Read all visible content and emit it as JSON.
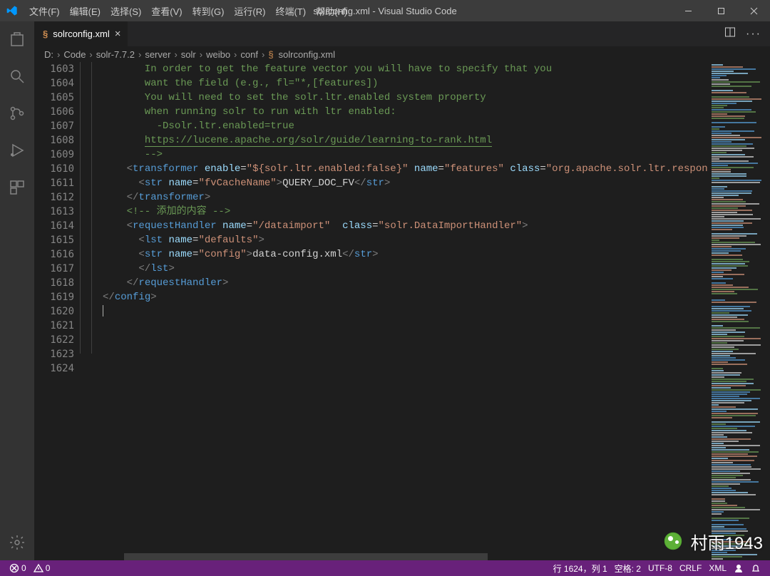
{
  "menu": {
    "file": "文件(F)",
    "edit": "编辑(E)",
    "select": "选择(S)",
    "view": "查看(V)",
    "goto": "转到(G)",
    "run": "运行(R)",
    "terminal": "终端(T)",
    "help": "帮助(H)"
  },
  "window_title": "solrconfig.xml - Visual Studio Code",
  "tab": {
    "label": "solrconfig.xml"
  },
  "breadcrumb": [
    "D:",
    "Code",
    "solr-7.7.2",
    "server",
    "solr",
    "weibo",
    "conf",
    "solrconfig.xml"
  ],
  "lines": {
    "start": 1603,
    "end": 1624,
    "rows": [
      {
        "n": 1603,
        "t": "cmt",
        "txt": "       In order to get the feature vector you will have to specify that you"
      },
      {
        "n": 1604,
        "t": "cmt",
        "txt": "       want the field (e.g., fl=\"*,[features])"
      },
      {
        "n": 1605,
        "t": "cmt",
        "txt": ""
      },
      {
        "n": 1606,
        "t": "cmt",
        "txt": "       You will need to set the solr.ltr.enabled system property"
      },
      {
        "n": 1607,
        "t": "cmt",
        "txt": "       when running solr to run with ltr enabled:"
      },
      {
        "n": 1608,
        "t": "cmt",
        "txt": "         -Dsolr.ltr.enabled=true"
      },
      {
        "n": 1609,
        "t": "cmt",
        "txt": ""
      },
      {
        "n": 1610,
        "t": "url",
        "txt": "       https://lucene.apache.org/solr/guide/learning-to-rank.html"
      },
      {
        "n": 1611,
        "t": "cmt",
        "txt": "       -->"
      },
      {
        "n": 1612,
        "t": "xml",
        "seg": [
          [
            "br",
            "    <"
          ],
          [
            "tag",
            "transformer"
          ],
          [
            "txt",
            " "
          ],
          [
            "attr",
            "enable"
          ],
          [
            "txt",
            "="
          ],
          [
            "str",
            "\"${solr.ltr.enabled:false}\""
          ],
          [
            "txt",
            " "
          ],
          [
            "attr",
            "name"
          ],
          [
            "txt",
            "="
          ],
          [
            "str",
            "\"features\""
          ],
          [
            "txt",
            " "
          ],
          [
            "attr",
            "class"
          ],
          [
            "txt",
            "="
          ],
          [
            "str",
            "\"org.apache.solr.ltr.response.t"
          ]
        ]
      },
      {
        "n": 1613,
        "t": "xml",
        "seg": [
          [
            "br",
            "      <"
          ],
          [
            "tag",
            "str"
          ],
          [
            "txt",
            " "
          ],
          [
            "attr",
            "name"
          ],
          [
            "txt",
            "="
          ],
          [
            "str",
            "\"fvCacheName\""
          ],
          [
            "br",
            ">"
          ],
          [
            "txt",
            "QUERY_DOC_FV"
          ],
          [
            "br",
            "</"
          ],
          [
            "tag",
            "str"
          ],
          [
            "br",
            ">"
          ]
        ]
      },
      {
        "n": 1614,
        "t": "xml",
        "seg": [
          [
            "br",
            "    </"
          ],
          [
            "tag",
            "transformer"
          ],
          [
            "br",
            ">"
          ]
        ]
      },
      {
        "n": 1615,
        "t": "xml",
        "seg": []
      },
      {
        "n": 1616,
        "t": "xml",
        "seg": [
          [
            "cmt",
            "    <!-- 添加的内容 -->"
          ]
        ]
      },
      {
        "n": 1617,
        "t": "xml",
        "seg": [
          [
            "br",
            "    <"
          ],
          [
            "tag",
            "requestHandler"
          ],
          [
            "txt",
            " "
          ],
          [
            "attr",
            "name"
          ],
          [
            "txt",
            "="
          ],
          [
            "str",
            "\"/dataimport\""
          ],
          [
            "txt",
            "  "
          ],
          [
            "attr",
            "class"
          ],
          [
            "txt",
            "="
          ],
          [
            "str",
            "\"solr.DataImportHandler\""
          ],
          [
            "br",
            ">"
          ]
        ]
      },
      {
        "n": 1618,
        "t": "xml",
        "seg": [
          [
            "br",
            "      <"
          ],
          [
            "tag",
            "lst"
          ],
          [
            "txt",
            " "
          ],
          [
            "attr",
            "name"
          ],
          [
            "txt",
            "="
          ],
          [
            "str",
            "\"defaults\""
          ],
          [
            "br",
            ">"
          ]
        ]
      },
      {
        "n": 1619,
        "t": "xml",
        "seg": [
          [
            "br",
            "      <"
          ],
          [
            "tag",
            "str"
          ],
          [
            "txt",
            " "
          ],
          [
            "attr",
            "name"
          ],
          [
            "txt",
            "="
          ],
          [
            "str",
            "\"config\""
          ],
          [
            "br",
            ">"
          ],
          [
            "txt",
            "data-config.xml"
          ],
          [
            "br",
            "</"
          ],
          [
            "tag",
            "str"
          ],
          [
            "br",
            ">"
          ]
        ]
      },
      {
        "n": 1620,
        "t": "xml",
        "seg": [
          [
            "br",
            "      </"
          ],
          [
            "tag",
            "lst"
          ],
          [
            "br",
            ">"
          ]
        ]
      },
      {
        "n": 1621,
        "t": "xml",
        "seg": [
          [
            "br",
            "    </"
          ],
          [
            "tag",
            "requestHandler"
          ],
          [
            "br",
            ">"
          ]
        ]
      },
      {
        "n": 1622,
        "t": "xml",
        "seg": []
      },
      {
        "n": 1623,
        "t": "xml",
        "seg": [
          [
            "br",
            "</"
          ],
          [
            "tag",
            "config"
          ],
          [
            "br",
            ">"
          ]
        ]
      },
      {
        "n": 1624,
        "t": "cursor",
        "txt": ""
      }
    ]
  },
  "status": {
    "errors": "0",
    "warnings": "0",
    "pos": "行 1624，列 1",
    "spaces": "空格: 2",
    "encoding": "UTF-8",
    "eol": "CRLF",
    "lang": "XML"
  },
  "watermark": "村雨1943"
}
